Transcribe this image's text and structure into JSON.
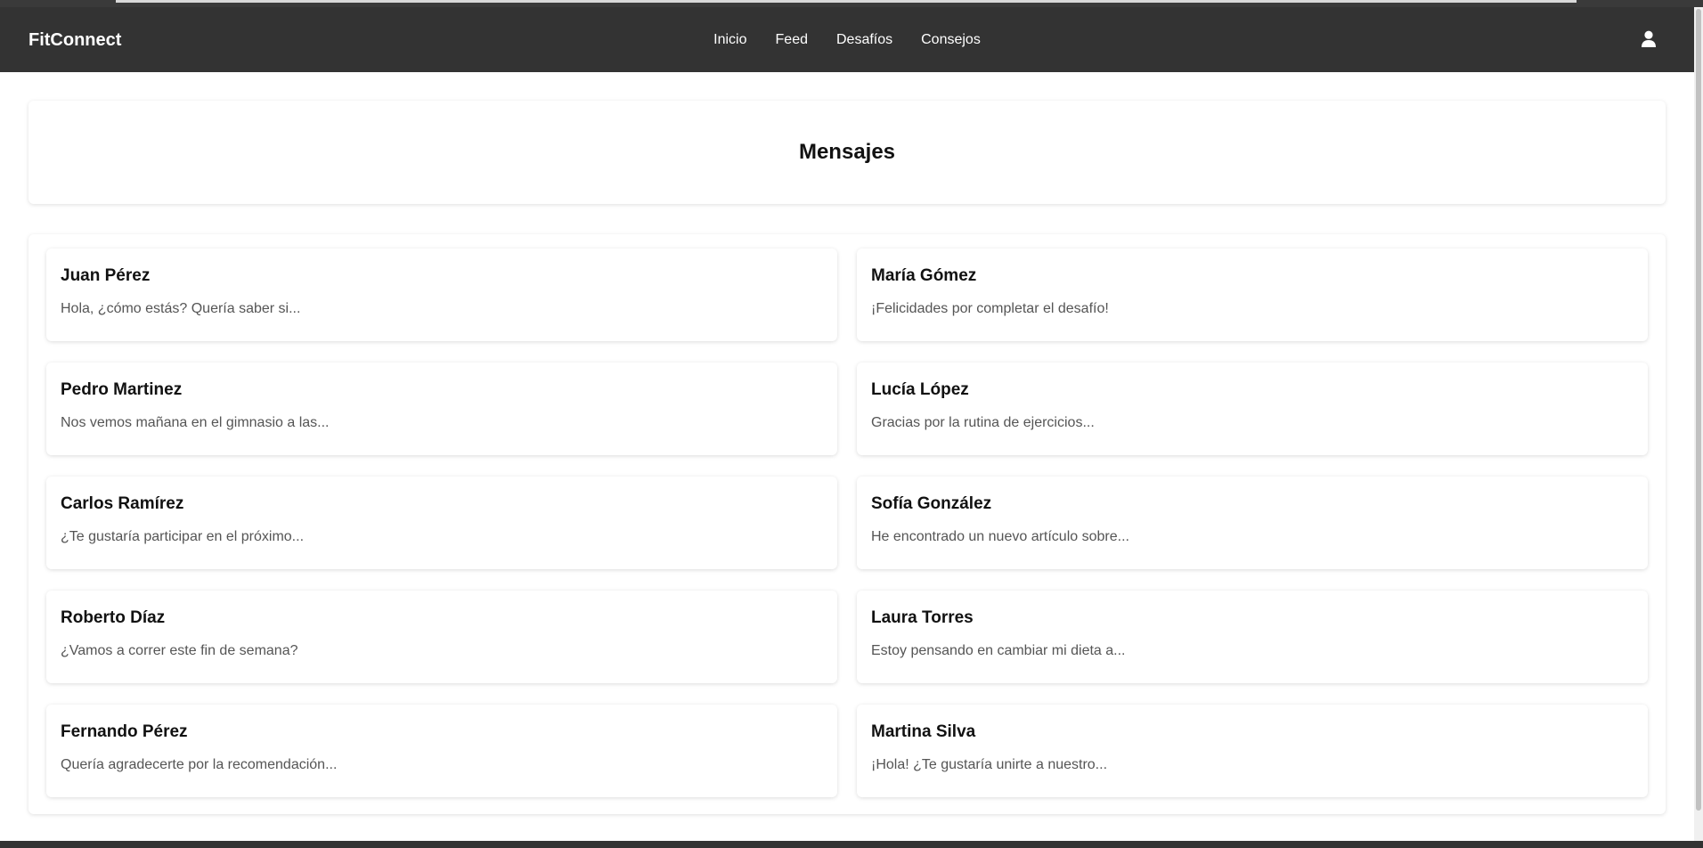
{
  "brand": "FitConnect",
  "nav": {
    "links": [
      "Inicio",
      "Feed",
      "Desafíos",
      "Consejos"
    ]
  },
  "icons": {
    "user": "user-icon"
  },
  "page": {
    "title": "Mensajes"
  },
  "messages": [
    {
      "name": "Juan Pérez",
      "preview": "Hola, ¿cómo estás? Quería saber si..."
    },
    {
      "name": "María Gómez",
      "preview": "¡Felicidades por completar el desafío!"
    },
    {
      "name": "Pedro Martinez",
      "preview": "Nos vemos mañana en el gimnasio a las..."
    },
    {
      "name": "Lucía López",
      "preview": "Gracias por la rutina de ejercicios..."
    },
    {
      "name": "Carlos Ramírez",
      "preview": "¿Te gustaría participar en el próximo..."
    },
    {
      "name": "Sofía González",
      "preview": "He encontrado un nuevo artículo sobre..."
    },
    {
      "name": "Roberto Díaz",
      "preview": "¿Vamos a correr este fin de semana?"
    },
    {
      "name": "Laura Torres",
      "preview": "Estoy pensando en cambiar mi dieta a..."
    },
    {
      "name": "Fernando Pérez",
      "preview": "Quería agradecerte por la recomendación..."
    },
    {
      "name": "Martina Silva",
      "preview": "¡Hola! ¿Te gustaría unirte a nuestro..."
    }
  ],
  "colors": {
    "navbar": "#333333",
    "preview_text": "#555555"
  }
}
